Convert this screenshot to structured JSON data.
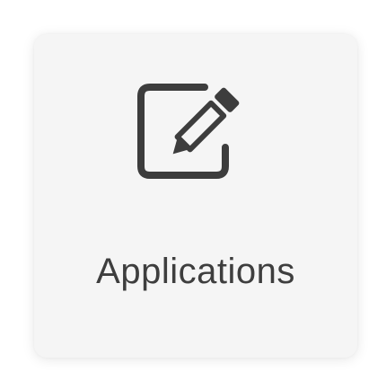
{
  "tile": {
    "label": "Applications",
    "icon": "edit-pencil-icon"
  },
  "colors": {
    "background": "#ffffff",
    "tile_background": "#f5f5f5",
    "icon": "#3d3d3d",
    "label_text": "#3e3e3e"
  }
}
